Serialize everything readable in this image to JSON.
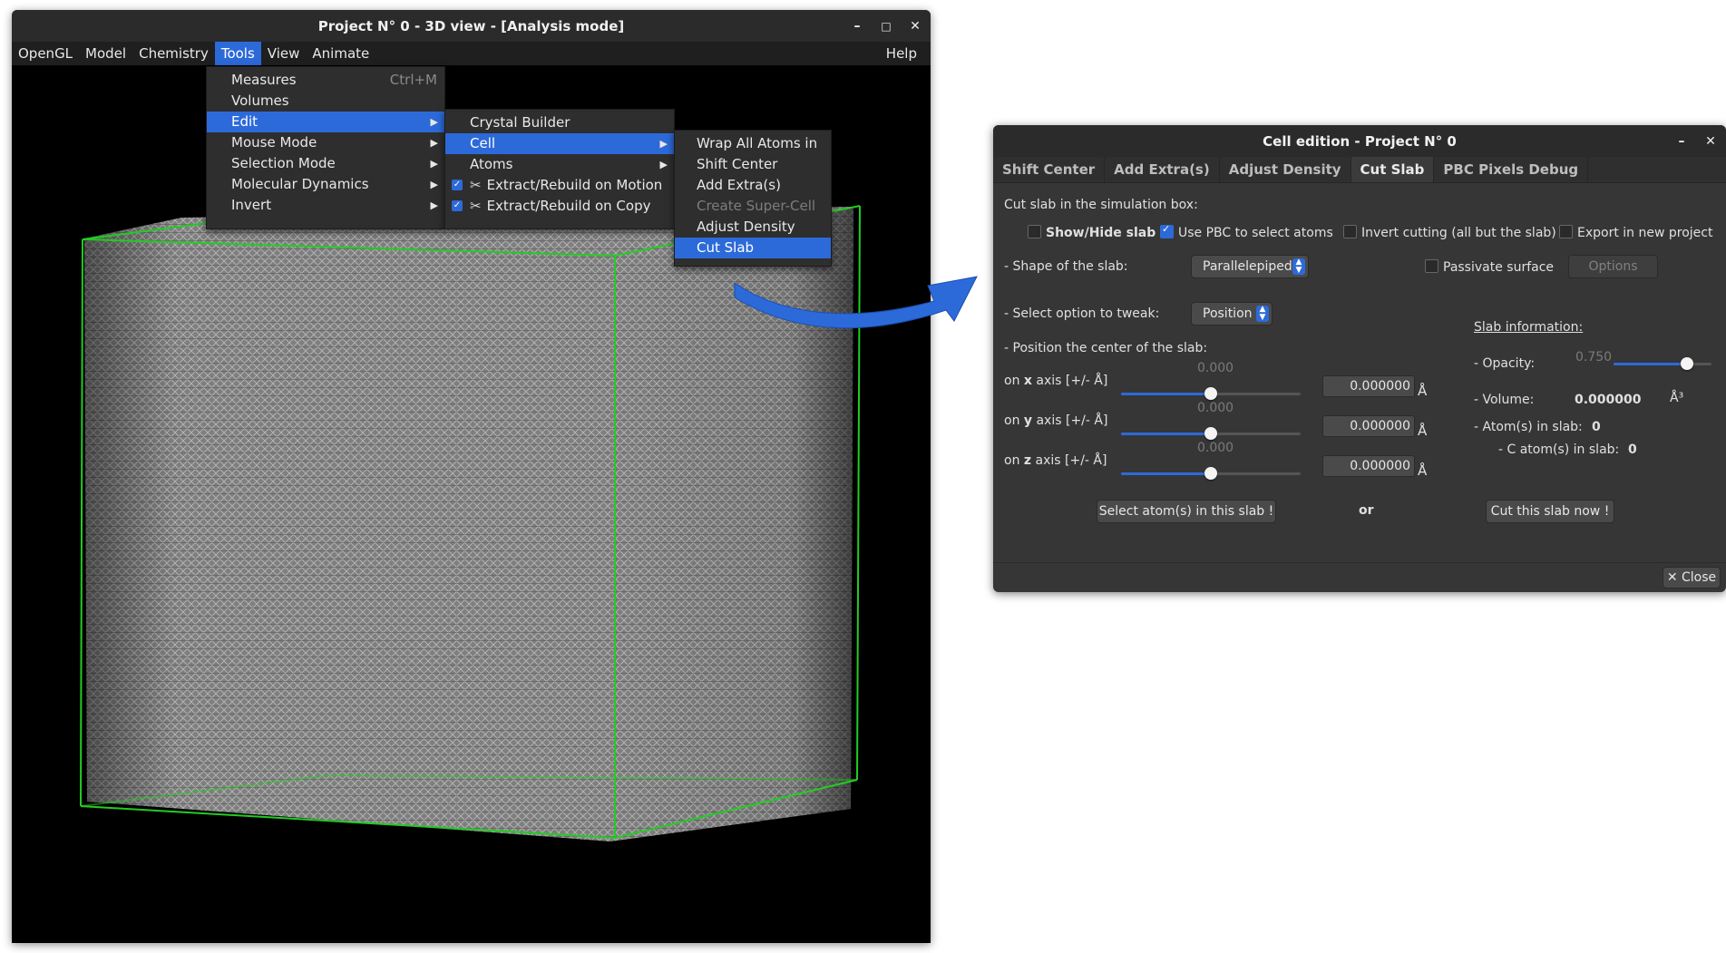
{
  "main_window": {
    "title": "Project N° 0 - 3D view - [Analysis mode]",
    "controls": {
      "minimize": "–",
      "maximize": "□",
      "close": "✕"
    },
    "menubar": [
      "OpenGL",
      "Model",
      "Chemistry",
      "Tools",
      "View",
      "Animate"
    ],
    "menubar_active": "Tools",
    "help": "Help"
  },
  "tools_menu": {
    "items": [
      {
        "label": "Measures",
        "accel": "Ctrl+M"
      },
      {
        "label": "Volumes"
      },
      {
        "label": "Edit",
        "submenu": true,
        "highlighted": true
      },
      {
        "label": "Mouse Mode",
        "submenu": true
      },
      {
        "label": "Selection Mode",
        "submenu": true
      },
      {
        "label": "Molecular Dynamics",
        "submenu": true
      },
      {
        "label": "Invert",
        "submenu": true
      }
    ]
  },
  "edit_menu": {
    "items": [
      {
        "label": "Crystal Builder"
      },
      {
        "label": "Cell",
        "submenu": true,
        "highlighted": true
      },
      {
        "label": "Atoms",
        "submenu": true
      },
      {
        "label": "Extract/Rebuild on Motion",
        "checked": true
      },
      {
        "label": "Extract/Rebuild on Copy",
        "checked": true
      }
    ]
  },
  "cell_menu": {
    "items": [
      {
        "label": "Wrap All Atoms in"
      },
      {
        "label": "Shift Center"
      },
      {
        "label": "Add Extra(s)"
      },
      {
        "label": "Create Super-Cell",
        "disabled": true
      },
      {
        "label": "Adjust Density"
      },
      {
        "label": "Cut Slab",
        "highlighted": true
      }
    ]
  },
  "dialog": {
    "title": "Cell edition - Project N° 0",
    "controls": {
      "minimize": "–",
      "close": "✕"
    },
    "tabs": [
      "Shift Center",
      "Add Extra(s)",
      "Adjust Density",
      "Cut Slab",
      "PBC Pixels Debug"
    ],
    "active_tab": "Cut Slab",
    "heading": "Cut slab in the simulation box:",
    "checks": {
      "show_hide": {
        "label": "Show/Hide slab",
        "checked": false
      },
      "use_pbc": {
        "label": "Use PBC to select atoms",
        "checked": true
      },
      "invert": {
        "label": "Invert cutting (all but the slab)",
        "checked": false
      },
      "export": {
        "label": "Export in new project",
        "checked": false
      },
      "passivate": {
        "label": "Passivate surface",
        "checked": false
      }
    },
    "shape_label": "- Shape of the slab:",
    "shape_value": "Parallelepiped",
    "options_button": "Options",
    "tweak_label": "- Select option to tweak:",
    "tweak_value": "Position",
    "position_label": "- Position the center of the slab:",
    "axes": [
      {
        "pre": "on ",
        "axis": "x",
        "post": " axis [+/- Å]",
        "slider_value": "0.000",
        "fraction": 0.5,
        "entry": "0.000000",
        "unit": "Å"
      },
      {
        "pre": "on ",
        "axis": "y",
        "post": " axis [+/- Å]",
        "slider_value": "0.000",
        "fraction": 0.5,
        "entry": "0.000000",
        "unit": "Å"
      },
      {
        "pre": "on ",
        "axis": "z",
        "post": " axis [+/- Å]",
        "slider_value": "0.000",
        "fraction": 0.5,
        "entry": "0.000000",
        "unit": "Å"
      }
    ],
    "slab_info": {
      "heading": "Slab information:",
      "opacity_label": "- Opacity:",
      "opacity_value": "0.750",
      "opacity_fraction": 0.75,
      "volume_label": "- Volume:",
      "volume_value": "0.000000",
      "volume_unit": "Å³",
      "atoms_label": "- Atom(s) in slab:",
      "atoms_value": "0",
      "c_atoms_label": "- C atom(s) in slab:",
      "c_atoms_value": "0"
    },
    "select_button": "Select atom(s) in this slab !",
    "or_label": "or",
    "cut_button": "Cut this slab now !",
    "close_button": "Close"
  },
  "colors": {
    "accent": "#2d6ad9",
    "lattice": "#9a9a9a",
    "cell_edges": "#22cc22",
    "arrow": "#2d6ad9"
  }
}
